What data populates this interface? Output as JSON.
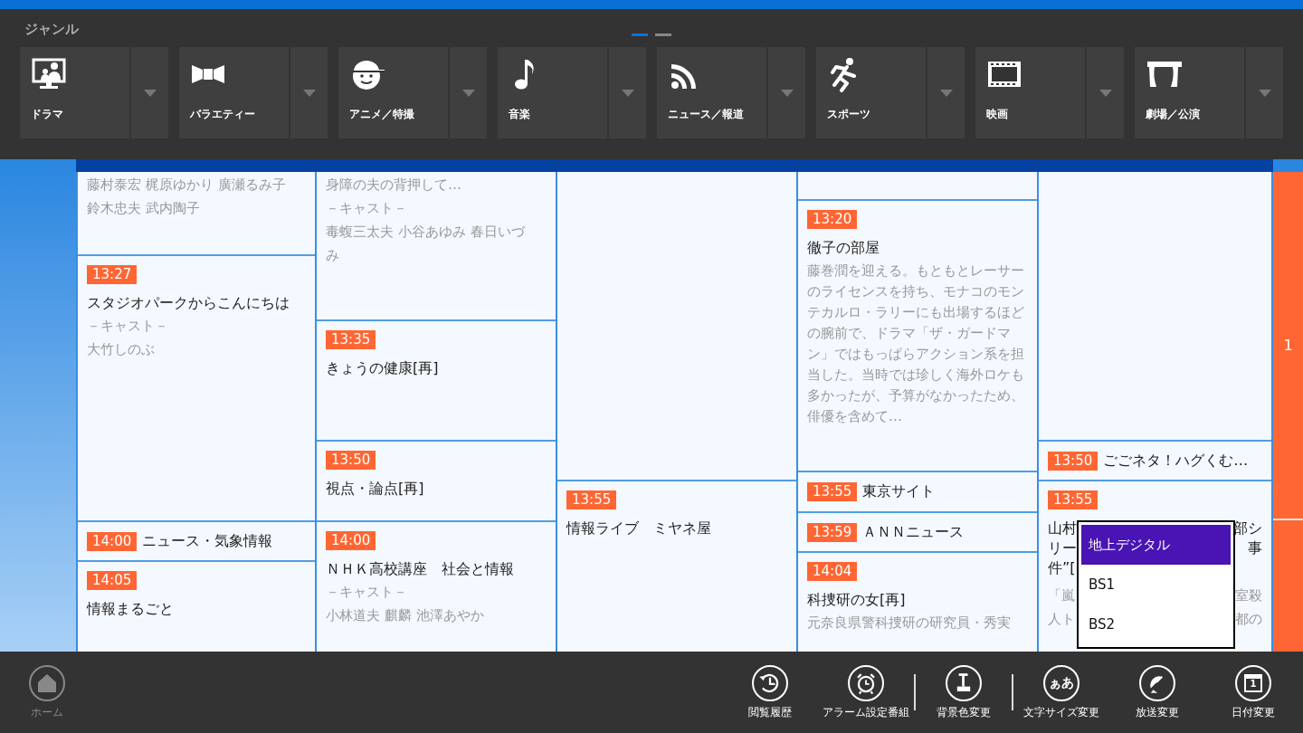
{
  "genre_bar": {
    "title": "ジャンル",
    "pages": [
      {
        "selected": true
      },
      {
        "selected": false
      }
    ],
    "genres": [
      {
        "label": "ドラマ"
      },
      {
        "label": "バラエティー"
      },
      {
        "label": "アニメ／特撮"
      },
      {
        "label": "音楽"
      },
      {
        "label": "ニュース／報道"
      },
      {
        "label": "スポーツ"
      },
      {
        "label": "映画"
      },
      {
        "label": "劇場／公演"
      }
    ]
  },
  "schedule": {
    "side_tab": "1",
    "columns": [
      {
        "cells": [
          {
            "kind": "cut",
            "notes": [
              "藤村泰宏 梶原ゆかり 廣瀬るみ子",
              "鈴木忠夫 武内陶子"
            ]
          },
          {
            "kind": "block",
            "time": "13:27",
            "title": "スタジオパークからこんにちは",
            "notes": [
              "－キャスト－",
              "大竹しのぶ"
            ]
          },
          {
            "kind": "inline",
            "time": "14:00",
            "title": "ニュース・気象情報"
          },
          {
            "kind": "block",
            "time": "14:05",
            "title": "情報まるごと"
          }
        ]
      },
      {
        "cells": [
          {
            "kind": "cut",
            "notes": [
              "身障の夫の背押して…",
              "－キャスト－",
              "毒蝮三太夫 小谷あゆみ 春日いづ",
              "み"
            ]
          },
          {
            "kind": "block",
            "time": "13:35",
            "title": "きょうの健康[再]"
          },
          {
            "kind": "block",
            "time": "13:50",
            "title": "視点・論点[再]"
          },
          {
            "kind": "block",
            "time": "14:00",
            "title": "ＮＨＫ高校講座　社会と情報",
            "notes": [
              "－キャスト－",
              "小林道夫 麒麟 池澤あやか"
            ]
          }
        ]
      },
      {
        "cells": [
          {
            "kind": "cut"
          },
          {
            "kind": "block",
            "time": "13:55",
            "title": "情報ライブ　ミヤネ屋"
          }
        ]
      },
      {
        "cells": [
          {
            "kind": "cut"
          },
          {
            "kind": "block",
            "time": "13:20",
            "title": "徹子の部屋",
            "notes": [
              "藤巻潤を迎える。もともとレーサーのライセンスを持ち、モナコのモンテカルロ・ラリーにも出場するほどの腕前で、ドラマ「ザ・ガードマン」ではもっぱらアクション系を担当した。当時では珍しく海外ロケも多かったが、予算がなかったため、俳優を含めて…"
            ]
          },
          {
            "kind": "inline",
            "time": "13:55",
            "title": "東京サイト"
          },
          {
            "kind": "inline",
            "time": "13:59",
            "title": "ＡＮＮニュース"
          },
          {
            "kind": "block",
            "time": "14:04",
            "title": "科捜研の女[再]",
            "notes": [
              "元奈良県警科捜研の研究員・秀実"
            ]
          }
        ]
      },
      {
        "cells": [
          {
            "kind": "cut"
          },
          {
            "kind": "inline",
            "time": "13:50",
            "title": "ごごネタ！ハグくむ…"
          },
          {
            "kind": "split",
            "time": "13:55",
            "title_parts": [
              [
                "山村",
                "部シ"
              ],
              [
                "リー",
                "事"
              ],
              [
                "件”["
              ]
            ],
            "note_parts": [
              [
                "「嵐",
                "室殺"
              ],
              [
                "人ト",
                "都の"
              ]
            ]
          }
        ]
      }
    ]
  },
  "broadcast_menu": {
    "items": [
      {
        "label": "地上デジタル",
        "selected": true
      },
      {
        "label": "BS1",
        "selected": false
      },
      {
        "label": "BS2",
        "selected": false
      }
    ]
  },
  "toolbar": {
    "home": {
      "label": "ホーム",
      "disabled": true
    },
    "buttons": [
      {
        "label": "閲覧履歴"
      },
      {
        "label": "アラーム設定番組"
      },
      {
        "label": "背景色変更"
      },
      {
        "label": "文字サイズ変更",
        "glyph": "ぁあ"
      },
      {
        "label": "放送変更"
      },
      {
        "label": "日付変更",
        "glyph": "1"
      }
    ]
  }
}
